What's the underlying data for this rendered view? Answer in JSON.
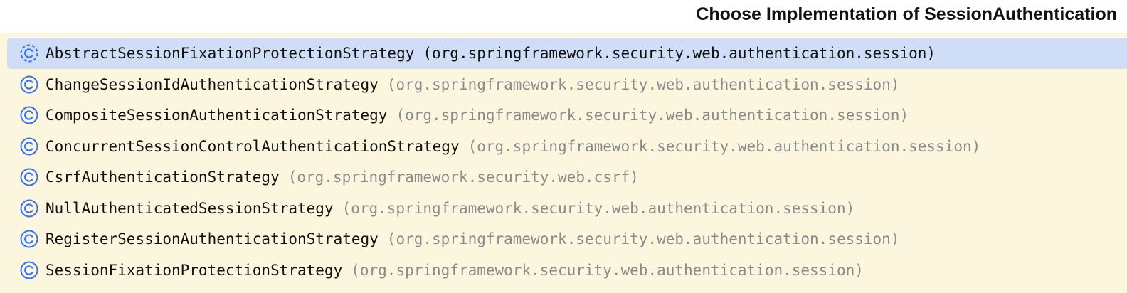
{
  "popup": {
    "title": "Choose Implementation of SessionAuthentication"
  },
  "items": [
    {
      "name": "AbstractSessionFixationProtectionStrategy",
      "package": "(org.springframework.security.web.authentication.session)",
      "icon": "abstract-class-icon",
      "selected": true
    },
    {
      "name": "ChangeSessionIdAuthenticationStrategy",
      "package": "(org.springframework.security.web.authentication.session)",
      "icon": "class-icon",
      "selected": false
    },
    {
      "name": "CompositeSessionAuthenticationStrategy",
      "package": "(org.springframework.security.web.authentication.session)",
      "icon": "class-icon",
      "selected": false
    },
    {
      "name": "ConcurrentSessionControlAuthenticationStrategy",
      "package": "(org.springframework.security.web.authentication.session)",
      "icon": "class-icon",
      "selected": false
    },
    {
      "name": "CsrfAuthenticationStrategy",
      "package": "(org.springframework.security.web.csrf)",
      "icon": "class-icon",
      "selected": false
    },
    {
      "name": "NullAuthenticatedSessionStrategy",
      "package": "(org.springframework.security.web.authentication.session)",
      "icon": "class-icon",
      "selected": false
    },
    {
      "name": "RegisterSessionAuthenticationStrategy",
      "package": "(org.springframework.security.web.authentication.session)",
      "icon": "class-icon",
      "selected": false
    },
    {
      "name": "SessionFixationProtectionStrategy",
      "package": "(org.springframework.security.web.authentication.session)",
      "icon": "class-icon",
      "selected": false
    }
  ],
  "colors": {
    "list_background": "#fdf6de",
    "selection": "#cfddf6",
    "icon_blue": "#3574f0",
    "package_gray": "#8b8b8b"
  }
}
